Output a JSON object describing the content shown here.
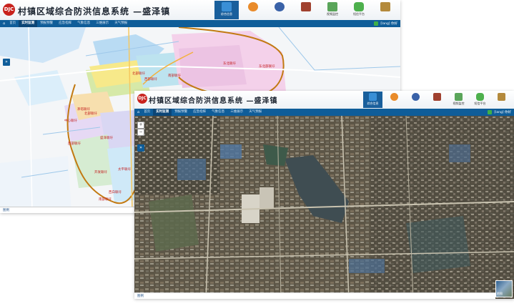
{
  "app": {
    "title": "村镇区域综合防洪信息系统 —盛泽镇",
    "logo_text": "DJC"
  },
  "modules": [
    {
      "label": "综合信息",
      "icon": "map-book-icon",
      "color": "#3a8fd6",
      "active": true
    },
    {
      "label": "",
      "icon": "user-orange-icon",
      "color": "#e98b2a",
      "active": false
    },
    {
      "label": "",
      "icon": "user-blue-icon",
      "color": "#3a62a8",
      "active": false
    },
    {
      "label": "",
      "icon": "books-icon",
      "color": "#a0412f",
      "active": false
    },
    {
      "label": "视频监控",
      "icon": "monitor-icon",
      "color": "#5aa55a",
      "active": false
    },
    {
      "label": "短信平台",
      "icon": "chat-icon",
      "color": "#4db04d",
      "active": false
    },
    {
      "label": "",
      "icon": "document-icon",
      "color": "#b48a3c",
      "active": false
    }
  ],
  "nav": {
    "home": "⌂",
    "tabs": [
      "首页",
      "实时监测",
      "预报预警",
      "应急指挥",
      "气象信息",
      "三维展示",
      "天气预报"
    ],
    "active_tab": 1,
    "user": "[lang] 你好"
  },
  "back_map": {
    "labels": [
      {
        "text": "北部联圩",
        "style": "red"
      },
      {
        "text": "西部联圩",
        "style": "red"
      },
      {
        "text": "南部联圩",
        "style": "red"
      },
      {
        "text": "东北联圩",
        "style": "red"
      },
      {
        "text": "东北部联圩",
        "style": "red"
      },
      {
        "text": "茅塔联圩",
        "style": "red"
      },
      {
        "text": "中心联圩",
        "style": "red"
      },
      {
        "text": "北部联圩",
        "style": "red"
      },
      {
        "text": "西部联圩",
        "style": "red"
      },
      {
        "text": "盛泽联圩",
        "style": "red"
      },
      {
        "text": "开发联圩",
        "style": "red"
      },
      {
        "text": "太平联圩",
        "style": "red"
      },
      {
        "text": "西白联圩",
        "style": "red"
      },
      {
        "text": "南部联圩",
        "style": "red"
      }
    ],
    "status_legend": "图例",
    "chips": [
      "地图",
      "影像图",
      "行政区划图",
      "标注"
    ]
  },
  "front_map": {
    "status_legend": "图例",
    "minimap_label": "地图"
  }
}
